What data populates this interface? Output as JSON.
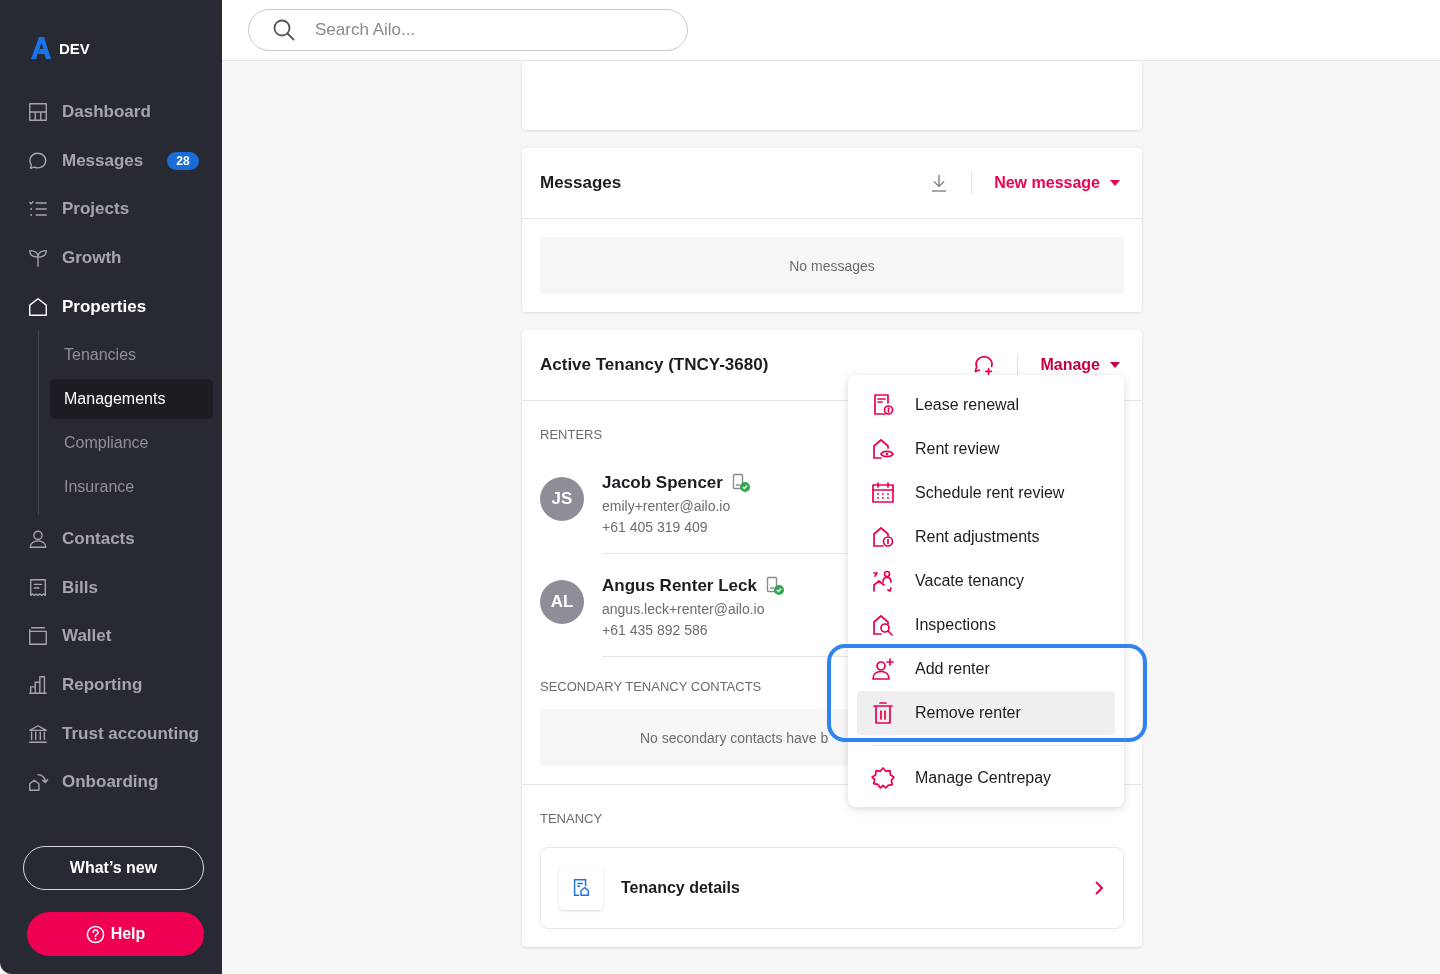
{
  "brand": {
    "label": "DEV"
  },
  "search": {
    "placeholder": "Search Ailo..."
  },
  "nav": [
    {
      "label": "Dashboard",
      "selected": false
    },
    {
      "label": "Messages",
      "selected": false,
      "badge": "28"
    },
    {
      "label": "Projects",
      "selected": false
    },
    {
      "label": "Growth",
      "selected": false
    },
    {
      "label": "Properties",
      "selected": true,
      "expanded": true,
      "children": [
        {
          "label": "Tenancies",
          "selected": false
        },
        {
          "label": "Managements",
          "selected": true
        },
        {
          "label": "Compliance",
          "selected": false
        },
        {
          "label": "Insurance",
          "selected": false
        }
      ]
    },
    {
      "label": "Contacts",
      "selected": false
    },
    {
      "label": "Bills",
      "selected": false
    },
    {
      "label": "Wallet",
      "selected": false
    },
    {
      "label": "Reporting",
      "selected": false
    },
    {
      "label": "Trust accounting",
      "selected": false
    },
    {
      "label": "Onboarding",
      "selected": false
    }
  ],
  "sidebar_buttons": {
    "whats_new": "What’s new",
    "help": "Help"
  },
  "messages_card": {
    "title": "Messages",
    "action": "New message",
    "empty": "No messages"
  },
  "tenancy_card": {
    "title": "Active Tenancy (TNCY-3680)",
    "action": "Manage",
    "renters_heading": "RENTERS",
    "renters": [
      {
        "initials": "JS",
        "name": "Jacob Spencer",
        "email": "emily+renter@ailo.io",
        "phone": "+61 405 319 409",
        "verified": true
      },
      {
        "initials": "AL",
        "name": "Angus Renter Leck",
        "email": "angus.leck+renter@ailo.io",
        "phone": "+61 435 892 586",
        "verified": true
      }
    ],
    "secondary_heading": "SECONDARY TENANCY CONTACTS",
    "secondary_empty": "No secondary contacts have b",
    "tenancy_heading": "TENANCY",
    "tenancy_link": "Tenancy details"
  },
  "manage_menu": {
    "groups": [
      {
        "divider": false,
        "outlined": false,
        "items": [
          {
            "label": "Lease renewal",
            "hovered": false
          },
          {
            "label": "Rent review",
            "hovered": false
          },
          {
            "label": "Schedule rent review",
            "hovered": false
          },
          {
            "label": "Rent adjustments",
            "hovered": false
          },
          {
            "label": "Vacate tenancy",
            "hovered": false
          },
          {
            "label": "Inspections",
            "hovered": false
          }
        ]
      },
      {
        "divider": false,
        "outlined": true,
        "items": [
          {
            "label": "Add renter",
            "hovered": false
          },
          {
            "label": "Remove renter",
            "hovered": true
          }
        ]
      },
      {
        "divider": true,
        "outlined": false,
        "items": [
          {
            "label": "Manage Centrepay",
            "hovered": false
          }
        ]
      }
    ]
  }
}
